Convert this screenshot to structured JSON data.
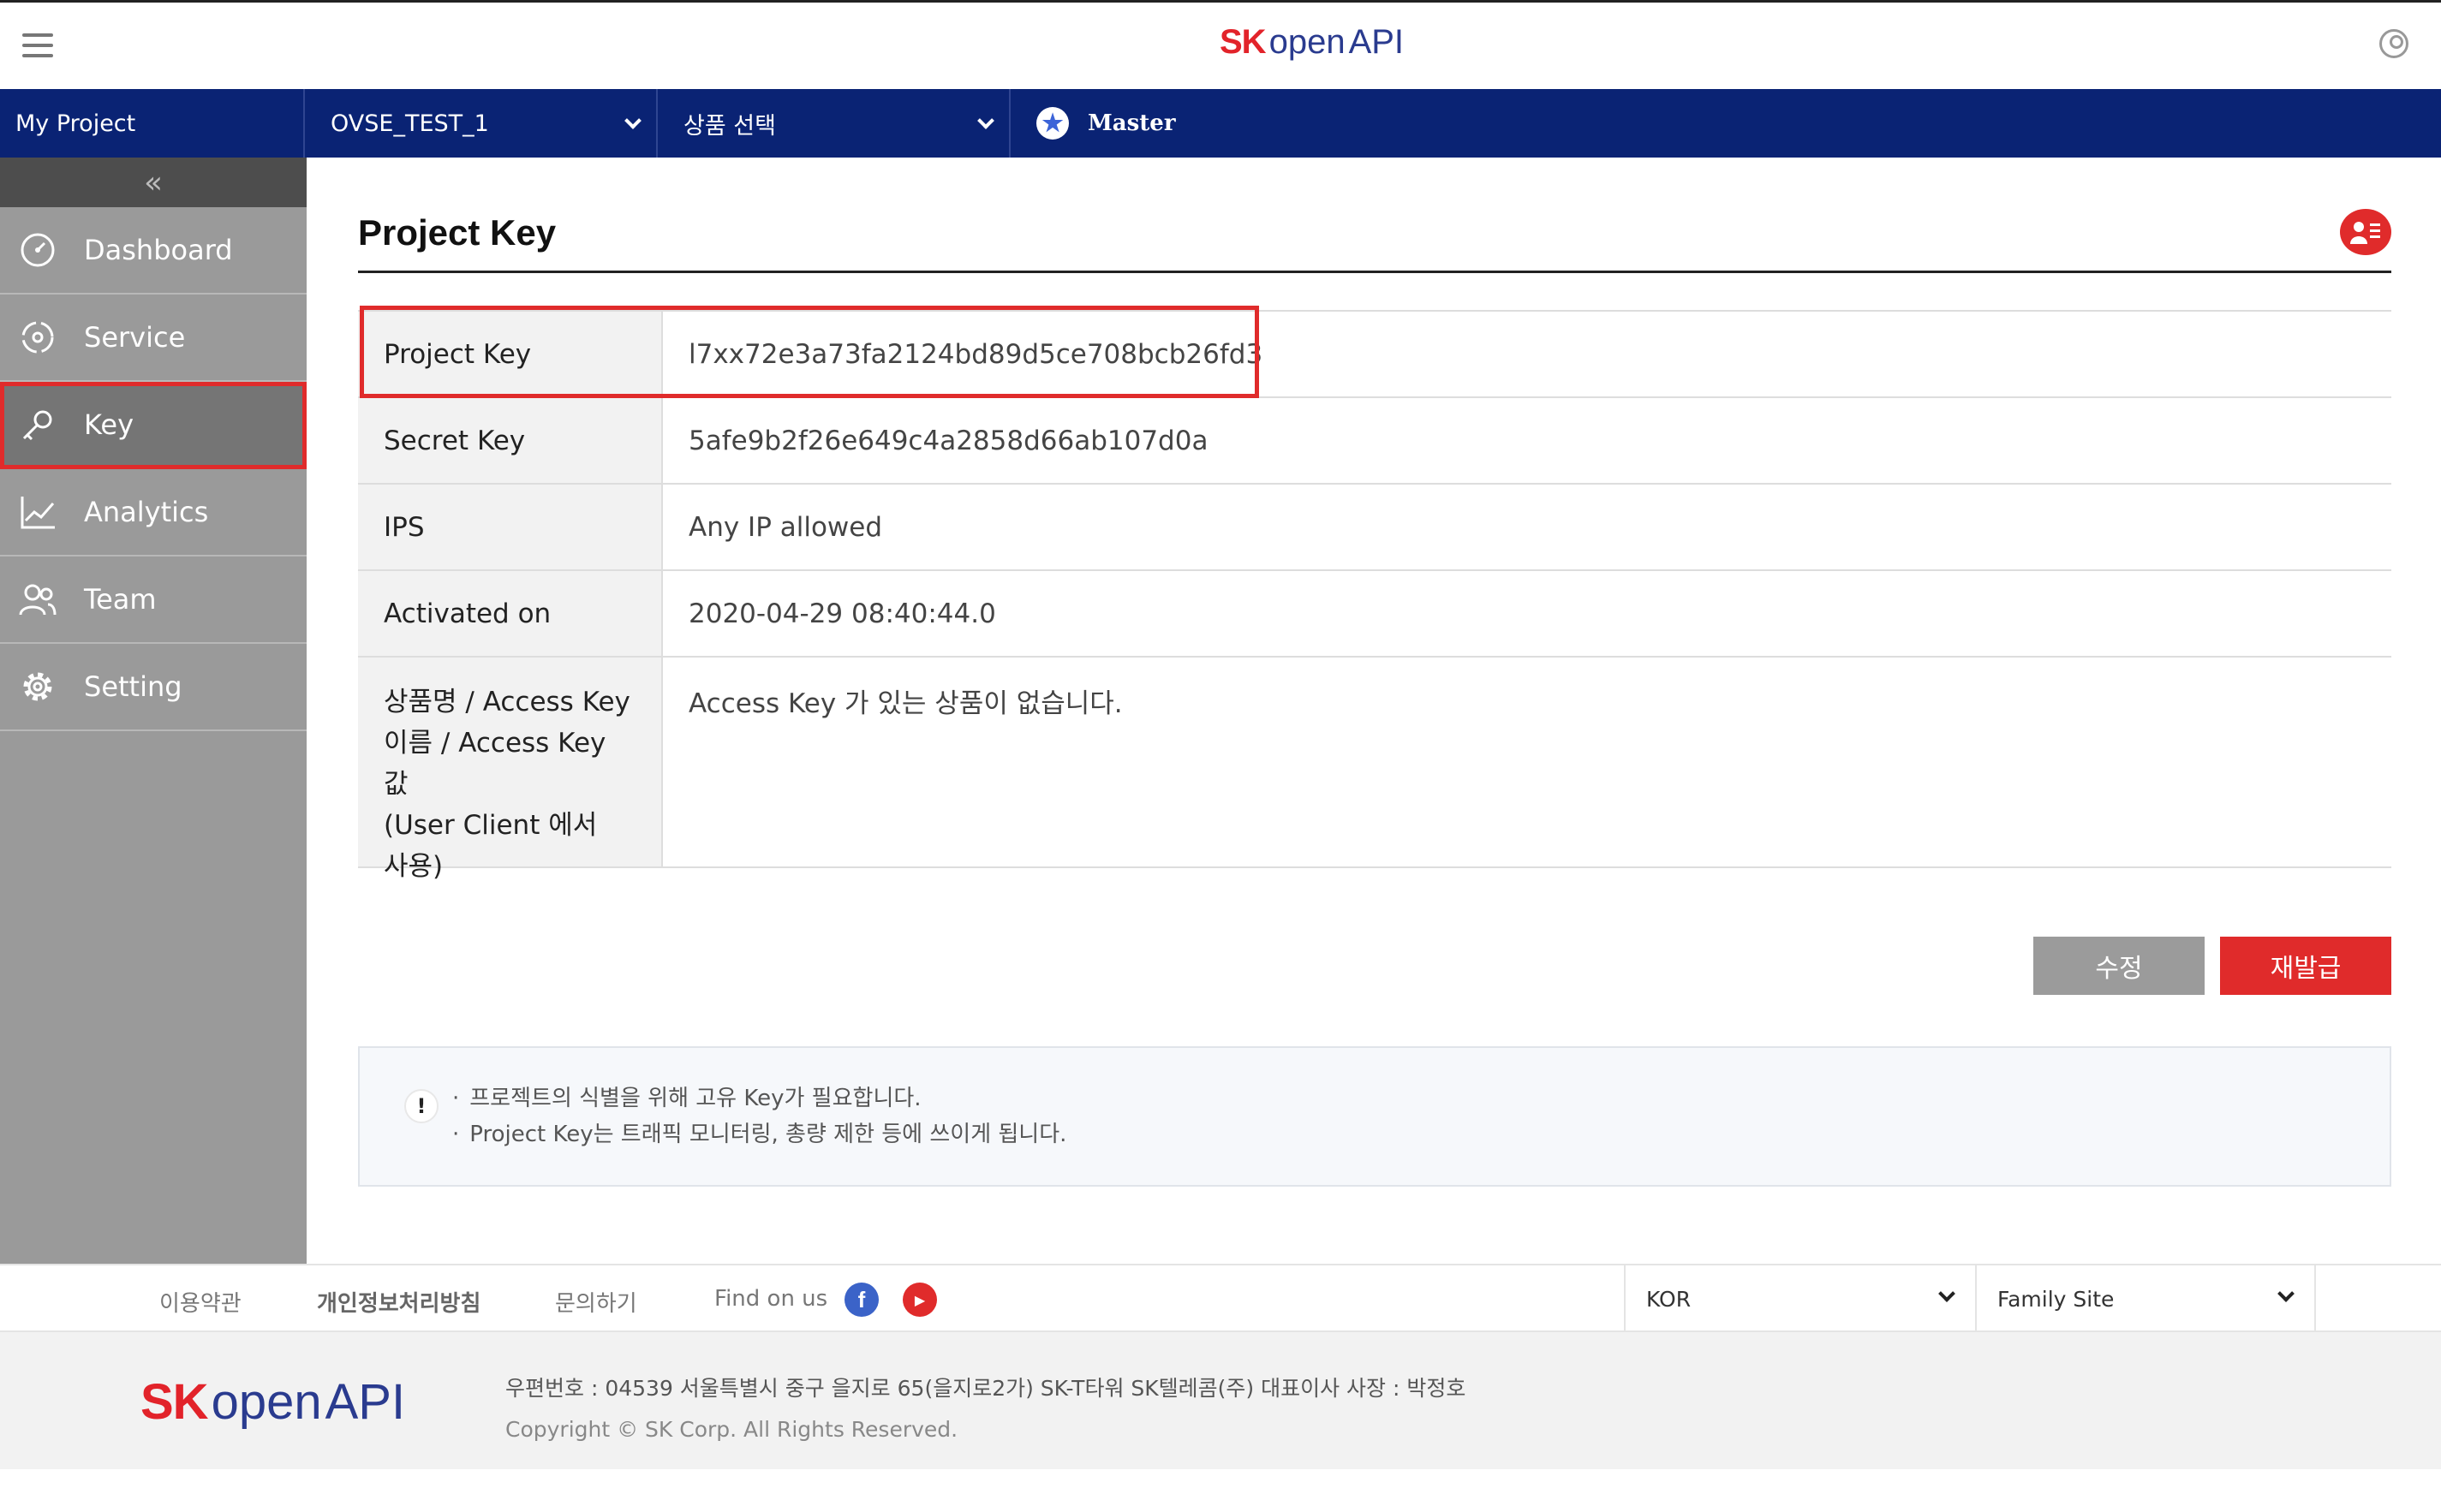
{
  "header": {
    "logo_sk": "SK",
    "logo_open": "open",
    "logo_api": "API",
    "menu_icon": "hamburger-icon",
    "user_icon": "user-circle-icon"
  },
  "navbar": {
    "project_label": "My Project",
    "project_select": "OVSE_TEST_1",
    "product_select": "상품 선택",
    "role_label": "Master",
    "role_icon": "star-icon"
  },
  "sidebar": {
    "collapse_glyph": "«",
    "items": [
      {
        "label": "Dashboard",
        "icon": "dashboard-icon"
      },
      {
        "label": "Service",
        "icon": "service-icon"
      },
      {
        "label": "Key",
        "icon": "key-icon",
        "active": true
      },
      {
        "label": "Analytics",
        "icon": "chart-icon"
      },
      {
        "label": "Team",
        "icon": "team-icon"
      },
      {
        "label": "Setting",
        "icon": "gear-icon"
      }
    ]
  },
  "main": {
    "title": "Project Key",
    "rows": [
      {
        "label": "Project Key",
        "value": "l7xx72e3a73fa2124bd89d5ce708bcb26fd3"
      },
      {
        "label": "Secret Key",
        "value": "5afe9b2f26e649c4a2858d66ab107d0a"
      },
      {
        "label": "IPS",
        "value": "Any IP allowed"
      },
      {
        "label": "Activated on",
        "value": "2020-04-29 08:40:44.0"
      },
      {
        "label_lines": [
          "상품명 / Access Key",
          "이름 / Access Key 값",
          "(User Client 에서",
          "사용)"
        ],
        "value": "Access Key 가 있는 상품이 없습니다."
      }
    ],
    "edit_button": "수정",
    "reissue_button": "재발급",
    "notice": {
      "icon_glyph": "!",
      "lines": [
        "프로젝트의 식별을 위해 고유 Key가 필요합니다.",
        "Project Key는 트래픽 모니터링, 총량 제한 등에 쓰이게 됩니다."
      ]
    }
  },
  "footer": {
    "links": [
      "이용약관",
      "개인정보처리방침",
      "문의하기"
    ],
    "find_on_us": "Find on us",
    "facebook_glyph": "f",
    "youtube_glyph": "▶",
    "language": "KOR",
    "family_site": "Family Site",
    "address": "우편번호 : 04539 서울특별시 중구 을지로 65(을지로2가) SK-T타워 SK텔레콤(주) 대표이사 사장 : 박정호",
    "copyright": "Copyright © SK Corp. All Rights Reserved."
  },
  "colors": {
    "navy": "#0a2374",
    "accent_red": "#e02b2b",
    "sidebar_gray": "#9a9a9a"
  }
}
